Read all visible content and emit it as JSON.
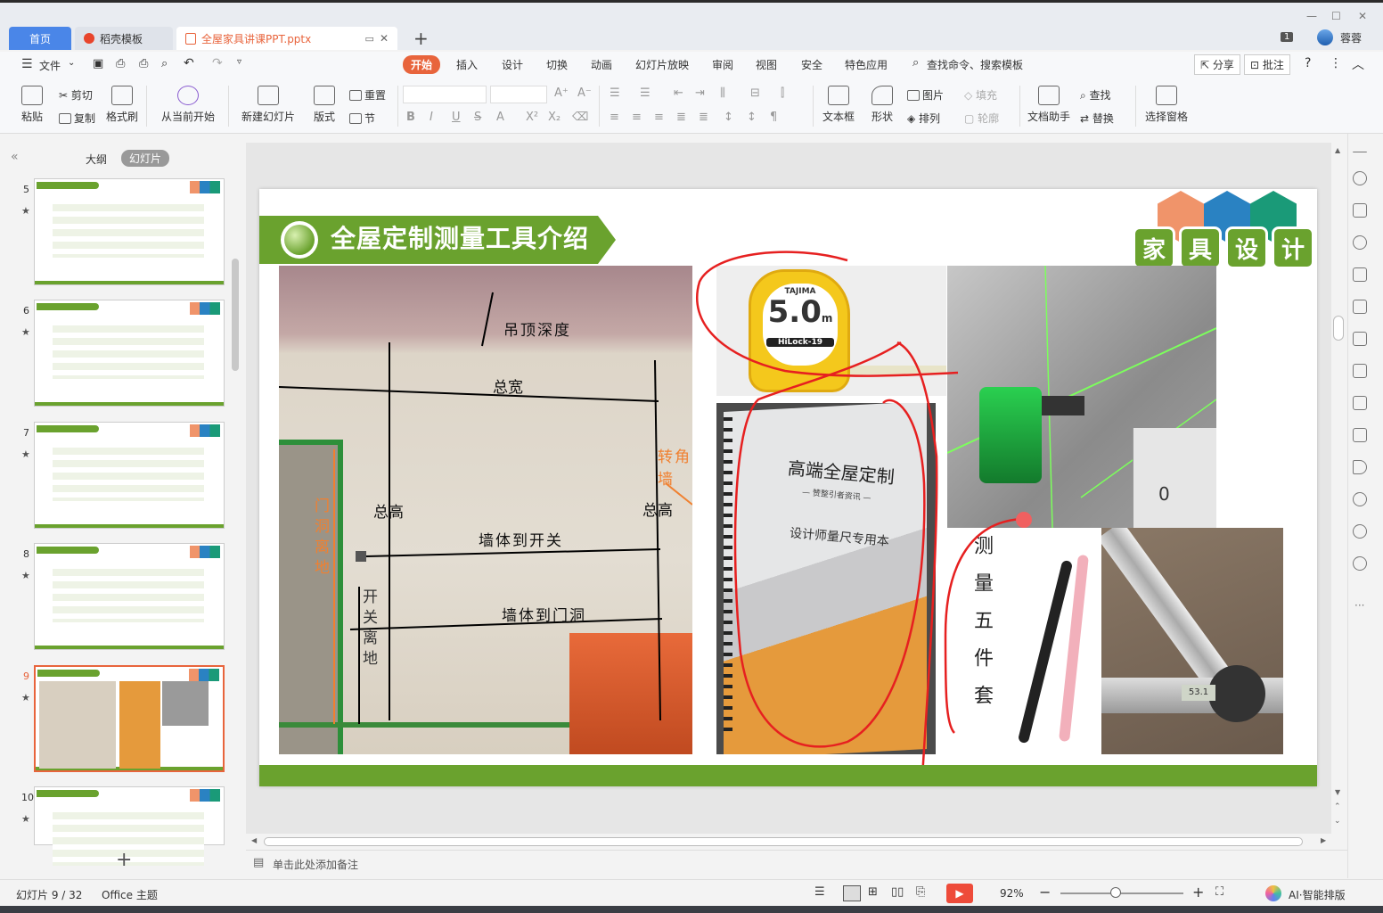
{
  "tabs": {
    "home": "首页",
    "template": "稻壳模板",
    "doc": "全屋家具讲课PPT.pptx"
  },
  "window": {
    "badge": "1",
    "user": "蓉蓉"
  },
  "quickbar": {
    "file": "文件"
  },
  "menus": [
    "开始",
    "插入",
    "设计",
    "切换",
    "动画",
    "幻灯片放映",
    "审阅",
    "视图",
    "安全",
    "特色应用"
  ],
  "search": "查找命令、搜索模板",
  "share": "分享",
  "review": "批注",
  "ribbon": {
    "paste": "粘贴",
    "cut": "剪切",
    "copy": "复制",
    "format_painter": "格式刷",
    "from_current": "从当前开始",
    "new_slide": "新建幻灯片",
    "layout": "版式",
    "reset": "重置",
    "section": "节",
    "textbox": "文本框",
    "shape": "形状",
    "picture": "图片",
    "fill": "填充",
    "arrange": "排列",
    "outline": "轮廓",
    "doc_helper": "文档助手",
    "find": "查找",
    "replace": "替换",
    "select_pane": "选择窗格"
  },
  "panel": {
    "outline": "大纲",
    "slides": "幻灯片"
  },
  "thumbnails": [
    {
      "num": "5"
    },
    {
      "num": "6"
    },
    {
      "num": "7"
    },
    {
      "num": "8"
    },
    {
      "num": "9"
    },
    {
      "num": "10"
    }
  ],
  "slide": {
    "title": "全屋定制测量工具介绍",
    "logo": [
      "家",
      "具",
      "设",
      "计"
    ],
    "labels": {
      "ceiling_depth": "吊顶深度",
      "total_width": "总宽",
      "total_height_left": "总高",
      "total_height_right": "总高",
      "wall_to_switch": "墙体到开关",
      "wall_to_door": "墙体到门洞",
      "corner_wall": "转角墙",
      "door_to_floor": "门洞离地",
      "switch_to_floor": "开关离地"
    },
    "tape": {
      "brand": "TAJIMA",
      "size": "5.0",
      "unit": "m",
      "model": "HiLock-19"
    },
    "notebook": {
      "title": "高端全屋定制",
      "sub": "— 赞整引者资讯 —",
      "ruler": "设计师量尺专用本"
    },
    "laser": {
      "zero": "0"
    },
    "five_set": "测量五件套",
    "caliper": "53.1"
  },
  "notes_placeholder": "单击此处添加备注",
  "status": {
    "slide": "幻灯片 9 / 32",
    "theme": "Office 主题",
    "zoom": "92%",
    "ai": "AI·智能排版"
  }
}
